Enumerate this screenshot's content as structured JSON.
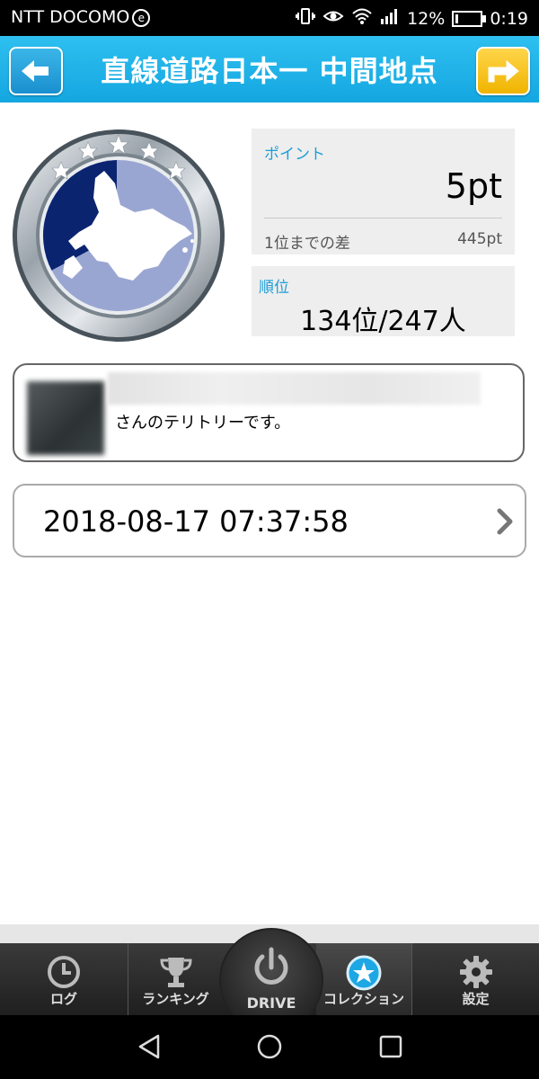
{
  "status_bar": {
    "carrier": "NTT DOCOMO",
    "carrier_badge": "e",
    "battery": "12%",
    "time": "0:19"
  },
  "header": {
    "title": "直線道路日本一 中間地点",
    "back_icon": "arrow-left-icon",
    "share_icon": "share-arrow-icon"
  },
  "points": {
    "label": "ポイント",
    "value": "5pt",
    "gap_label": "1位までの差",
    "gap_value": "445pt"
  },
  "rank": {
    "label": "順位",
    "value": "134位/247人"
  },
  "territory": {
    "text": "さんのテリトリーです。"
  },
  "visit": {
    "timestamp": "2018-08-17 07:37:58"
  },
  "tabs": [
    {
      "label": "ログ",
      "icon": "clock-icon"
    },
    {
      "label": "ランキング",
      "icon": "trophy-icon"
    },
    {
      "label": "DRIVE",
      "icon": "power-icon"
    },
    {
      "label": "コレクション",
      "icon": "star-icon"
    },
    {
      "label": "設定",
      "icon": "gear-icon"
    }
  ],
  "colors": {
    "header": "#14a6e0",
    "accent_label": "#1e9ed6",
    "share_button": "#f0b400"
  }
}
